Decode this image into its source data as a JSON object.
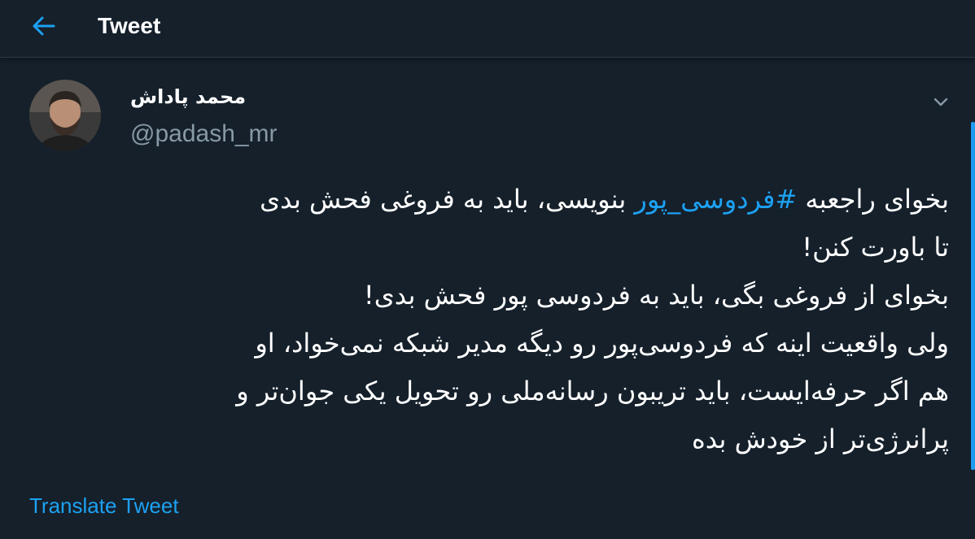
{
  "header": {
    "title": "Tweet",
    "back_icon": "arrow-left-icon"
  },
  "author": {
    "name": "محمد پاداش",
    "handle": "@padash_mr",
    "avatar_icon": "avatar"
  },
  "menu": {
    "caret_icon": "chevron-down-icon"
  },
  "tweet": {
    "line1_start": "بخوای راجعبه ",
    "hashtag": "#فردوسی_پور",
    "line1_end": " بنویسی، باید به فروغی فحش بدی",
    "line2": "تا باورت کنن!",
    "line3": "بخوای از فروغی بگی، باید به فردوسی پور فحش بدی!",
    "line4": "ولی واقعیت اینه که فردوسی‌پور رو دیگه مدیر شبکه نمی‌خواد، او",
    "line5": "هم اگر حرفه‌ایست، باید تریبون رسانه‌ملی رو تحویل یکی جوان‌تر و",
    "line6": "پرانرژی‌تر از خودش بده"
  },
  "translate": {
    "label": "Translate Tweet"
  },
  "colors": {
    "background": "#15202b",
    "accent": "#1da1f2",
    "secondary_text": "#8899a6"
  }
}
